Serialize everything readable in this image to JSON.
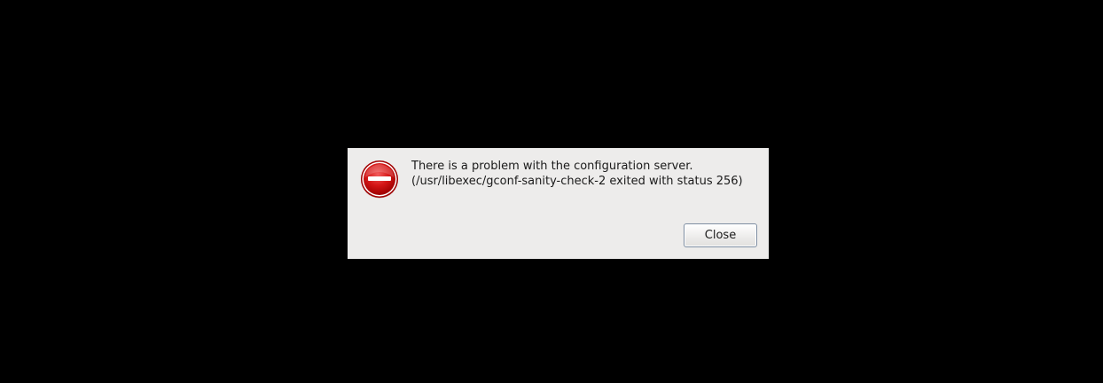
{
  "dialog": {
    "icon": "error-stop-icon",
    "message_line1": "There is a problem with the configuration server.",
    "message_line2": "(/usr/libexec/gconf-sanity-check-2 exited with status 256)",
    "close_label": "Close"
  },
  "colors": {
    "background": "#000000",
    "dialog_bg": "#edeceb",
    "icon_red": "#cc0000",
    "button_border": "#7f8ea2"
  }
}
